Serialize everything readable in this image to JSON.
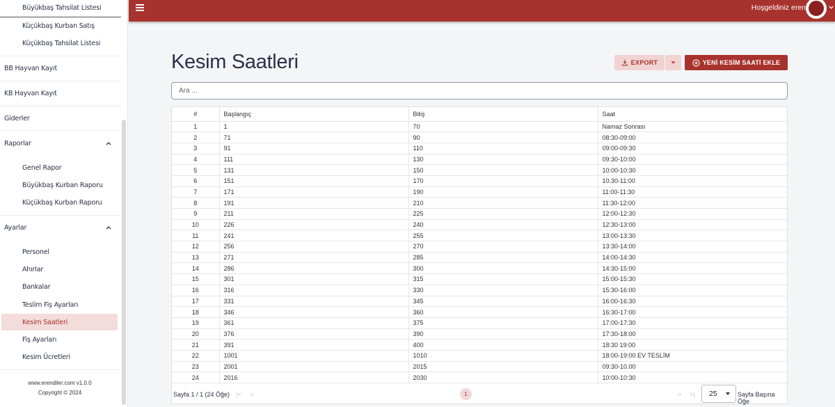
{
  "sidebar": {
    "top_items": [
      "Büyükbaş Tahsilat Listesi",
      "Küçükbaş Kurban Satış",
      "Küçükbaş Tahsilat Listesi"
    ],
    "groups": {
      "bb_hayvan": "BB Hayvan Kayıt",
      "kb_hayvan": "KB Hayvan Kayıt",
      "giderler": "Giderler",
      "raporlar": "Raporlar",
      "ayarlar": "Ayarlar"
    },
    "raporlar_items": [
      "Genel Rapor",
      "Büyükbaş Kurban Raporu",
      "Küçükbaş Kurban Raporu"
    ],
    "ayarlar_items": [
      "Personel",
      "Ahırlar",
      "Bankalar",
      "Teslim Fiş Ayarları",
      "Kesim Saatleri",
      "Fiş Ayarları",
      "Kesim Ücretleri"
    ],
    "footer_version": "www.erendiler.com v1.0.0",
    "footer_copyright": "Copyright © 2024"
  },
  "topbar": {
    "welcome": "Hoşgeldiniz eren",
    "accent": "#a8322d"
  },
  "page": {
    "title": "Kesim Saatleri",
    "export_label": "EXPORT",
    "add_label": "YENİ KESİM SAATİ EKLE",
    "search_placeholder": "Ara ..."
  },
  "table": {
    "headers": [
      "#",
      "Başlangıç",
      "Bitiş",
      "Saat"
    ],
    "rows": [
      [
        "1",
        "1",
        "70",
        "Namaz Sonrası"
      ],
      [
        "2",
        "71",
        "90",
        "08:30-09:00"
      ],
      [
        "3",
        "91",
        "110",
        "09:00-09:30"
      ],
      [
        "4",
        "111",
        "130",
        "09:30-10:00"
      ],
      [
        "5",
        "131",
        "150",
        "10:00-10:30"
      ],
      [
        "6",
        "151",
        "170",
        "10.30-11:00"
      ],
      [
        "7",
        "171",
        "190",
        "11:00-11:30"
      ],
      [
        "8",
        "191",
        "210",
        "11:30-12:00"
      ],
      [
        "9",
        "211",
        "225",
        "12:00-12:30"
      ],
      [
        "10",
        "226",
        "240",
        "12:30-13:00"
      ],
      [
        "11",
        "241",
        "255",
        "13:00-13:30"
      ],
      [
        "12",
        "256",
        "270",
        "13:30-14:00"
      ],
      [
        "13",
        "271",
        "285",
        "14:00-14:30"
      ],
      [
        "14",
        "286",
        "300",
        "14:30-15:00"
      ],
      [
        "15",
        "301",
        "315",
        "15:00-15:30"
      ],
      [
        "16",
        "316",
        "330",
        "15:30-16:00"
      ],
      [
        "17",
        "331",
        "345",
        "16:00-16:30"
      ],
      [
        "18",
        "346",
        "360",
        "16:30-17:00"
      ],
      [
        "19",
        "361",
        "375",
        "17:00-17:30"
      ],
      [
        "20",
        "376",
        "390",
        "17:30-18:00"
      ],
      [
        "21",
        "391",
        "400",
        "18:30 19:00"
      ],
      [
        "22",
        "1001",
        "1010",
        "18:00-19:00 EV TESLİM"
      ],
      [
        "23",
        "2001",
        "2015",
        "09:30-10.00"
      ],
      [
        "24",
        "2016",
        "2030",
        "10:00-10:30"
      ]
    ]
  },
  "pager": {
    "info": "Sayfa 1 / 1 (24 Öğe)",
    "current_page": "1",
    "per_page": "25",
    "per_page_label": "Sayfa Başına Öğe"
  }
}
